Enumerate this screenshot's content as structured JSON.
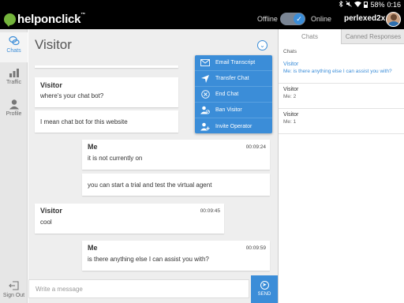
{
  "status_bar": {
    "battery": "58%",
    "time": "0:16"
  },
  "app_bar": {
    "logo_text": "helponclick",
    "logo_tm": "™",
    "offline_label": "Offline",
    "online_label": "Online",
    "toggle_on": true,
    "username": "perlexed2x"
  },
  "left_nav": {
    "items": [
      {
        "label": "Chats",
        "icon": "chats-icon",
        "active": true
      },
      {
        "label": "Traffic",
        "icon": "traffic-icon",
        "active": false
      },
      {
        "label": "Profile",
        "icon": "profile-icon",
        "active": false
      }
    ],
    "sign_out": {
      "label": "Sign Out",
      "icon": "sign-out-icon"
    }
  },
  "chat": {
    "title": "Visitor",
    "messages": [
      {
        "sender": "Visitor",
        "time": "",
        "text": "where's your chat bot?"
      },
      {
        "sender": "",
        "time": "",
        "text": "I mean chat bot for this website"
      },
      {
        "sender": "Me",
        "time": "00:09:24",
        "text": "it is not currently on"
      },
      {
        "sender": "",
        "time": "",
        "text": "you can start a trial and test the virtual agent"
      },
      {
        "sender": "Visitor",
        "time": "00:09:45",
        "text": "cool"
      },
      {
        "sender": "Me",
        "time": "00:09:59",
        "text": "is there anything else I can assist you with?"
      }
    ],
    "input_placeholder": "Write a message",
    "send_label": "SEND"
  },
  "menu": {
    "items": [
      {
        "label": "Email Transcript",
        "icon": "email-icon"
      },
      {
        "label": "Transfer Chat",
        "icon": "transfer-icon"
      },
      {
        "label": "End Chat",
        "icon": "end-chat-icon"
      },
      {
        "label": "Ban Visitor",
        "icon": "ban-visitor-icon"
      },
      {
        "label": "Invite Operator",
        "icon": "invite-operator-icon"
      }
    ]
  },
  "right_panel": {
    "tabs": [
      {
        "label": "Chats",
        "active": true
      },
      {
        "label": "Canned Responses",
        "active": false
      }
    ],
    "section_label": "Chats",
    "chat_list": [
      {
        "name": "Visitor",
        "preview": "Me: is there anything else I can assist you with?",
        "active": true
      },
      {
        "name": "Visitor",
        "preview": "Me: 2",
        "active": false
      },
      {
        "name": "Visitor",
        "preview": "Me: 1",
        "active": false
      }
    ]
  },
  "colors": {
    "accent": "#3b8dd8",
    "logo_green": "#74b43c",
    "app_bar_bg": "#000000",
    "chat_bg": "#eeeeee"
  }
}
